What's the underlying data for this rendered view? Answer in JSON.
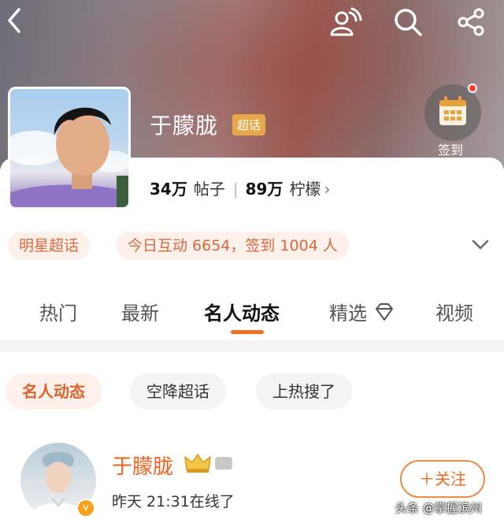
{
  "header": {
    "icons": [
      "back-icon",
      "fans-icon",
      "search-icon",
      "share-icon"
    ]
  },
  "profile": {
    "name": "于朦胧",
    "badge": "超话",
    "checkin_label": "签到",
    "posts_count": "34万",
    "posts_label": "帖子",
    "fans_count": "89万",
    "fans_label": "柠檬",
    "stats_chevron": "›"
  },
  "pills": {
    "category": "明星超话",
    "today": "今日互动 6654，签到 1004 人"
  },
  "tabs": [
    {
      "label": "热门"
    },
    {
      "label": "最新"
    },
    {
      "label": "名人动态"
    },
    {
      "label": "精选"
    },
    {
      "label": "视频"
    }
  ],
  "filter_chips": [
    {
      "label": "名人动态"
    },
    {
      "label": "空降超话"
    },
    {
      "label": "上热搜了"
    }
  ],
  "post": {
    "user_name": "于朦胧",
    "status": "昨天 21:31在线了",
    "follow_label": "＋关注",
    "verify_mark": "v"
  },
  "watermark": "头条 @掌握滨州",
  "colors": {
    "accent": "#f26d1e",
    "pill_bg": "#fdf0ea",
    "badge_gold": "#e7a84a"
  }
}
